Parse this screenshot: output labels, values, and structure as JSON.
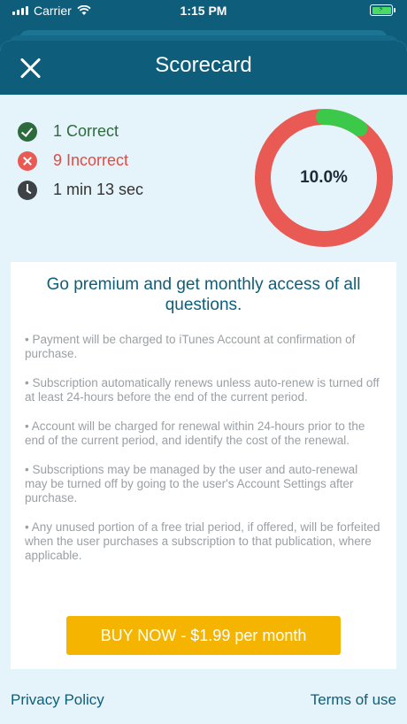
{
  "status_bar": {
    "carrier": "Carrier",
    "time": "1:15 PM"
  },
  "header": {
    "title": "Scorecard",
    "close_icon": "close-icon"
  },
  "stats": {
    "correct": "1 Correct",
    "incorrect": "9 Incorrect",
    "time": "1 min 13 sec"
  },
  "score": {
    "label": "10.0%",
    "fraction": 0.1,
    "colors": {
      "correct": "#3cc94a",
      "incorrect": "#e85a53"
    }
  },
  "promo": {
    "headline": "Go premium and get monthly access of all questions.",
    "terms": [
      "• Payment will be charged to iTunes Account at confirmation of purchase.",
      "• Subscription automatically renews unless auto-renew is turned off at least 24-hours before the end of the current period.",
      "• Account will be charged for renewal within 24-hours prior to the end of the current period, and identify the cost of the renewal.",
      "• Subscriptions may be managed by the user and auto-renewal may be turned off by going to the user's Account Settings after purchase.",
      "• Any unused portion of a free trial period, if offered, will be forfeited when the user purchases a subscription to that publication, where applicable."
    ],
    "buy_label": "BUY NOW - $1.99 per month",
    "accent": "#f4b400"
  },
  "footer": {
    "privacy": "Privacy Policy",
    "terms": "Terms of use"
  }
}
